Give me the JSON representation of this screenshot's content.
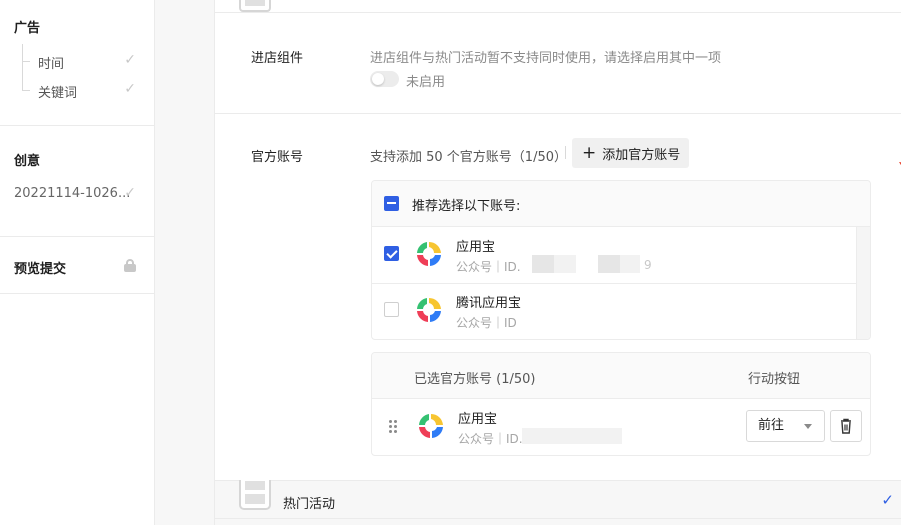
{
  "sidebar": {
    "ad": {
      "title": "广告",
      "items": [
        {
          "label": "时间",
          "check": "✓"
        },
        {
          "label": "关键词",
          "check": "✓"
        }
      ]
    },
    "creative": {
      "title": "创意",
      "items": [
        {
          "label": "20221114-1026...",
          "check": "✓"
        }
      ]
    },
    "preview": {
      "title": "预览提交",
      "icon": "lock-icon"
    }
  },
  "store_component": {
    "label": "进店组件",
    "hint": "进店组件与热门活动暂不支持同时使用，请选择启用其中一项",
    "toggle_state": "未启用",
    "enabled": false
  },
  "official_accounts": {
    "label": "官方账号",
    "hint": "支持添加 50 个官方账号（1/50）",
    "add_button": "添加官方账号",
    "add_icon": "+",
    "recommended": {
      "header": "推荐选择以下账号:",
      "accounts": [
        {
          "name": "应用宝",
          "meta": "公众号｜ID.",
          "id_tail": "9",
          "checked": true
        },
        {
          "name": "腾讯应用宝",
          "meta": "公众号｜ID",
          "checked": false
        }
      ]
    },
    "selected": {
      "col_account": "已选官方账号 (1/50)",
      "col_action": "行动按钮",
      "rows": [
        {
          "name": "应用宝",
          "meta": "公众号｜ID.",
          "action": "前往"
        }
      ]
    }
  },
  "hot_activity": {
    "label": "热门活动",
    "check": "✓"
  },
  "colors": {
    "accent": "#2f5fe3",
    "arrow": "#e8412c",
    "logo_blue": "#2f7cf6",
    "logo_green": "#35c172",
    "logo_yellow": "#f7c531",
    "logo_red": "#ef3e57"
  }
}
